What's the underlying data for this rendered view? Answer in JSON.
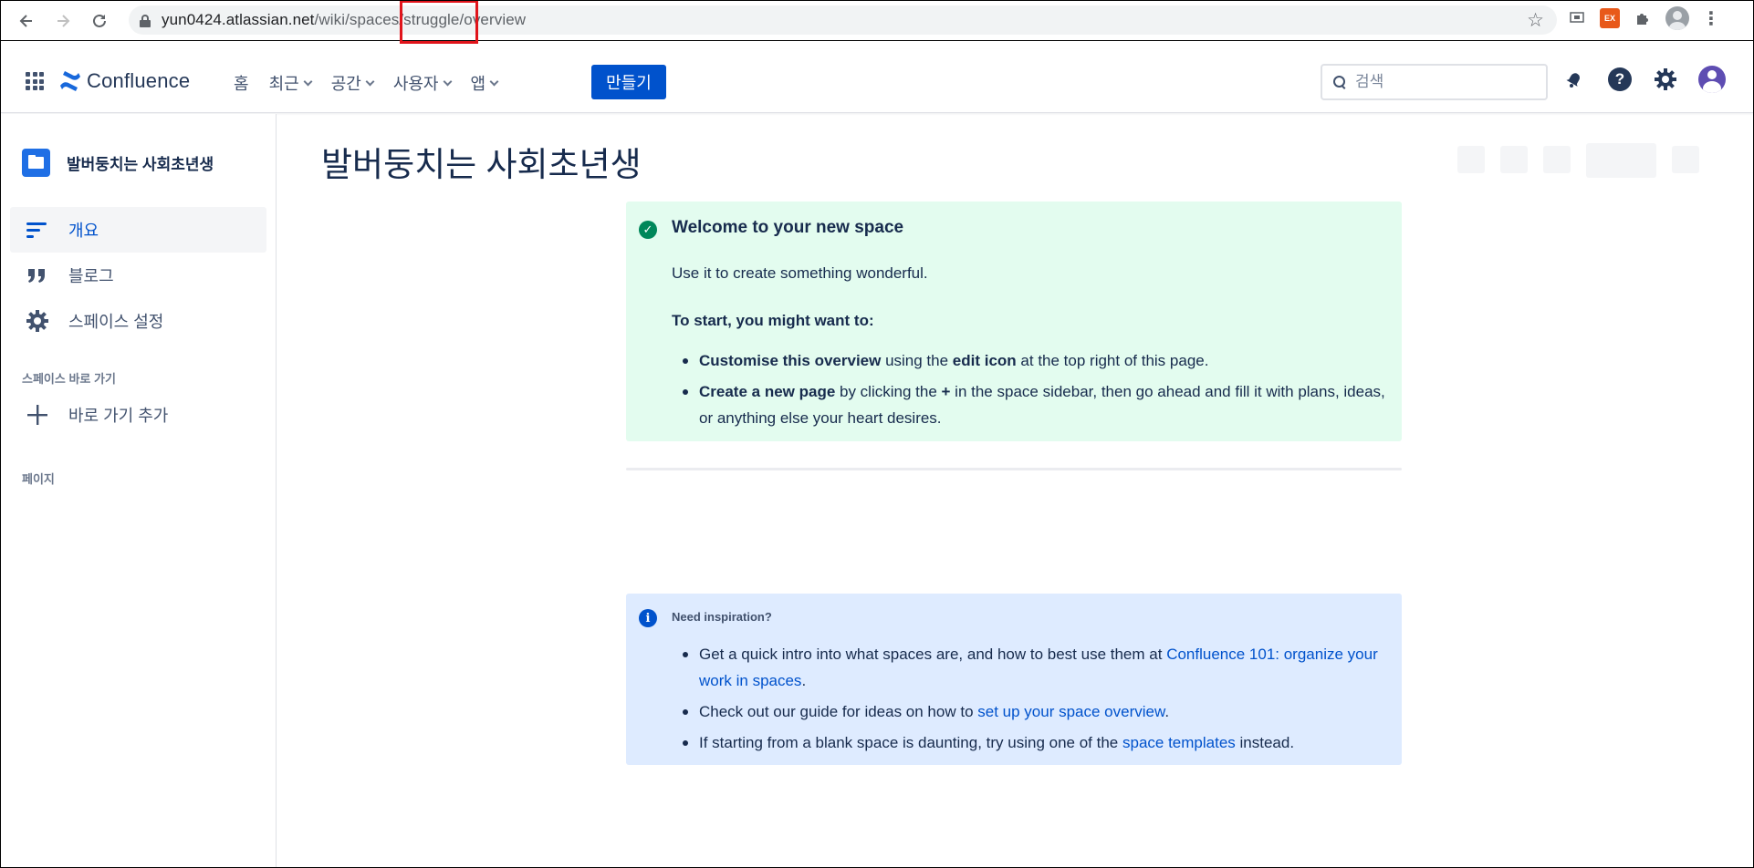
{
  "browser": {
    "url_host": "yun0424.atlassian.net",
    "url_path": "/wiki/spaces/struggle/overview"
  },
  "topnav": {
    "logo_text": "Confluence",
    "items": [
      {
        "label": "홈"
      },
      {
        "label": "최근"
      },
      {
        "label": "공간"
      },
      {
        "label": "사용자"
      },
      {
        "label": "앱"
      }
    ],
    "create_label": "만들기",
    "search_placeholder": "검색",
    "help_glyph": "?"
  },
  "sidebar": {
    "space_name": "발버둥치는 사회초년생",
    "items": [
      {
        "label": "개요"
      },
      {
        "label": "블로그"
      },
      {
        "label": "스페이스 설정"
      }
    ],
    "shortcuts_label": "스페이스 바로 가기",
    "add_shortcut_label": "바로 가기 추가",
    "pages_label": "페이지"
  },
  "main": {
    "title": "발버둥치는 사회초년생",
    "welcome": {
      "title": "Welcome to your new space",
      "subtitle": "Use it to create something wonderful.",
      "start_heading": "To start, you might want to:",
      "item1_bold": "Customise this overview",
      "item1_text1": " using the ",
      "item1_bold2": "edit icon",
      "item1_text2": " at the top right of this page.",
      "item2_bold": "Create a new page",
      "item2_text1": " by clicking the ",
      "item2_bold2": "+",
      "item2_text2": " in the space sidebar, then go ahead and fill it with plans, ideas, or anything else your heart desires."
    },
    "inspiration": {
      "title": "Need inspiration?",
      "item1_text": "Get a quick intro into what spaces are, and how to best use them at ",
      "item1_link": "Confluence 101: organize your work in spaces",
      "item1_end": ".",
      "item2_text": "Check out our guide for ideas on how to ",
      "item2_link": "set up your space overview",
      "item2_end": ".",
      "item3_text": "If starting from a blank space is daunting, try using one of the ",
      "item3_link": "space templates",
      "item3_end": " instead."
    }
  },
  "colors": {
    "brand": "#0052cc",
    "success_bg": "#e3fcef",
    "success_icon": "#00875a",
    "info_bg": "#deebff",
    "info_icon": "#0052cc",
    "highlight": "#e0141b"
  }
}
